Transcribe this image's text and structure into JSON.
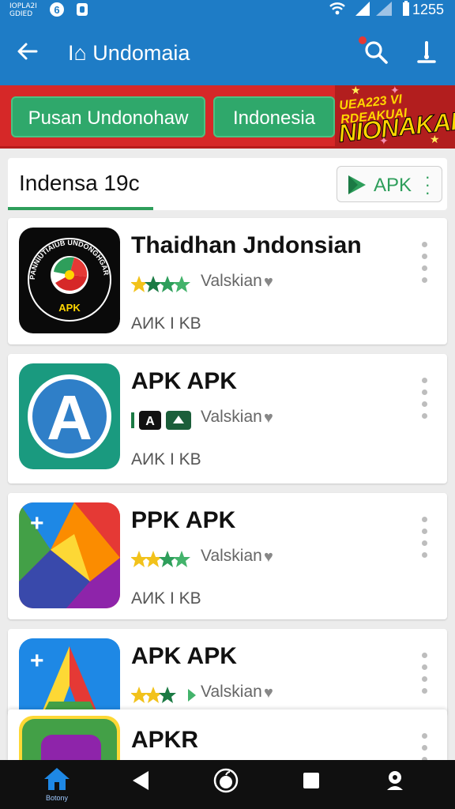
{
  "status_bar": {
    "carrier_line1": "IOPLA2I",
    "carrier_line2": "GDIED",
    "time": "1255"
  },
  "app_bar": {
    "title": "I⌂ Undomaia",
    "icons": [
      "back-arrow-icon",
      "search-icon",
      "profile-icon"
    ],
    "color": "#1e7cc6"
  },
  "filter_bar": {
    "chips": [
      "Pusan Undonohaw",
      "Indonesia"
    ],
    "promo_line1": "UEA223 VI RDEAKUAI",
    "promo_line2": "NIONAKAIS"
  },
  "section": {
    "title": "Indensa 19c",
    "button_label": "APK",
    "accent": "#2e9e5b"
  },
  "apps": [
    {
      "name": "Thaidhan Jndonsian",
      "version_label": "Valskian",
      "size": "AИK I KB",
      "icon_badge": "APK",
      "icon_text": "PANNIUTIAIUB UNDONGHGAR BHALIEE"
    },
    {
      "name": "APK APK",
      "version_label": "Valskian",
      "size": "AИK I KB",
      "icon_letter": "A"
    },
    {
      "name": "PPK APK",
      "version_label": "Valskian",
      "size": "AИK I KB",
      "icon_plus": "+"
    },
    {
      "name": "APK APK",
      "version_label": "Valskian",
      "size": "",
      "icon_plus": "+"
    },
    {
      "name": "APKR",
      "version_label": "",
      "size": ""
    }
  ],
  "nav_bar": {
    "home_label": "Botony",
    "icons": [
      "home-icon",
      "back-triangle-icon",
      "apple-circle-icon",
      "square-icon",
      "person-icon"
    ]
  }
}
